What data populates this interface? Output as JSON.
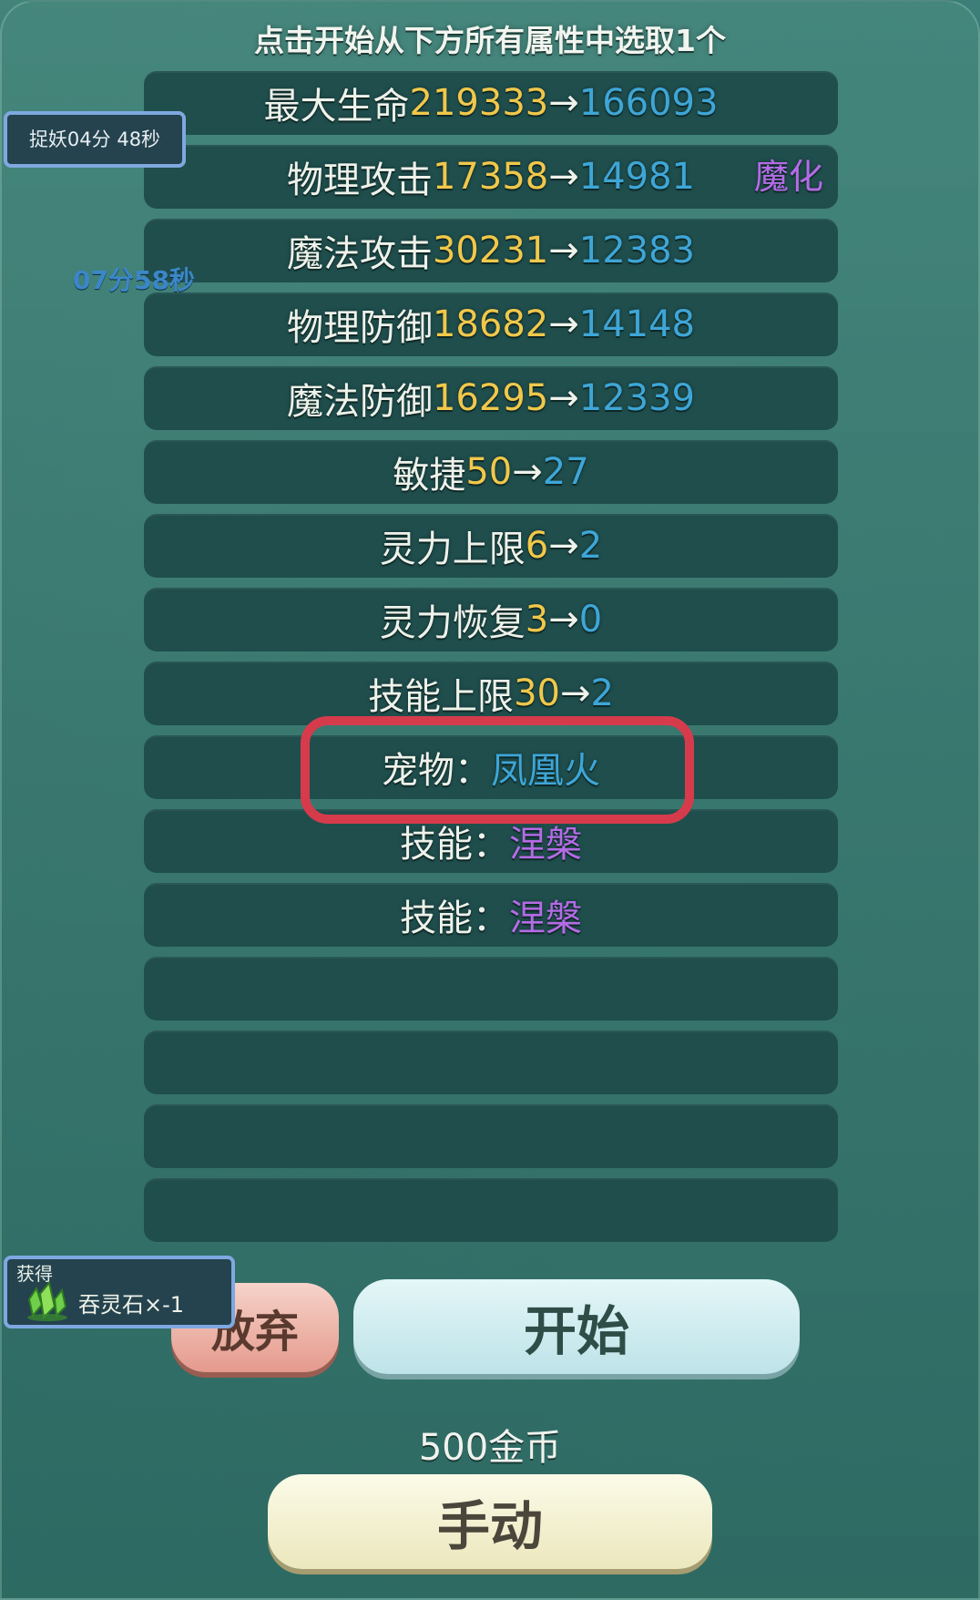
{
  "title": "点击开始从下方所有属性中选取1个",
  "timer_top": "捉妖04分 48秒",
  "timer_side": "07分58秒",
  "attributes": [
    {
      "name": "最大生命",
      "old": "219333",
      "new": "166093",
      "tag": ""
    },
    {
      "name": "物理攻击",
      "old": "17358",
      "new": "14981",
      "tag": "魔化"
    },
    {
      "name": "魔法攻击",
      "old": "30231",
      "new": "12383",
      "tag": ""
    },
    {
      "name": "物理防御",
      "old": "18682",
      "new": "14148",
      "tag": ""
    },
    {
      "name": "魔法防御",
      "old": "16295",
      "new": "12339",
      "tag": ""
    },
    {
      "name": "敏捷",
      "old": "50",
      "new": "27",
      "tag": ""
    },
    {
      "name": "灵力上限",
      "old": "6",
      "new": "2",
      "tag": ""
    },
    {
      "name": "灵力恢复",
      "old": "3",
      "new": "0",
      "tag": ""
    },
    {
      "name": "技能上限",
      "old": "30",
      "new": "2",
      "tag": ""
    }
  ],
  "arrow": "→",
  "pet": {
    "label": "宠物：",
    "value": "凤凰火"
  },
  "skills": [
    {
      "label": "技能：",
      "value": "涅槃"
    },
    {
      "label": "技能：",
      "value": "涅槃"
    }
  ],
  "gain": {
    "label": "获得",
    "item": "吞灵石×-1",
    "icon": "green-crystal-icon"
  },
  "buttons": {
    "give_up": "放弃",
    "start": "开始",
    "manual": "手动"
  },
  "cost": "500金币",
  "colors": {
    "old_value": "#f1c84a",
    "new_value": "#3ea6d7",
    "purple": "#b46be6",
    "highlight": "#d63b4c"
  }
}
